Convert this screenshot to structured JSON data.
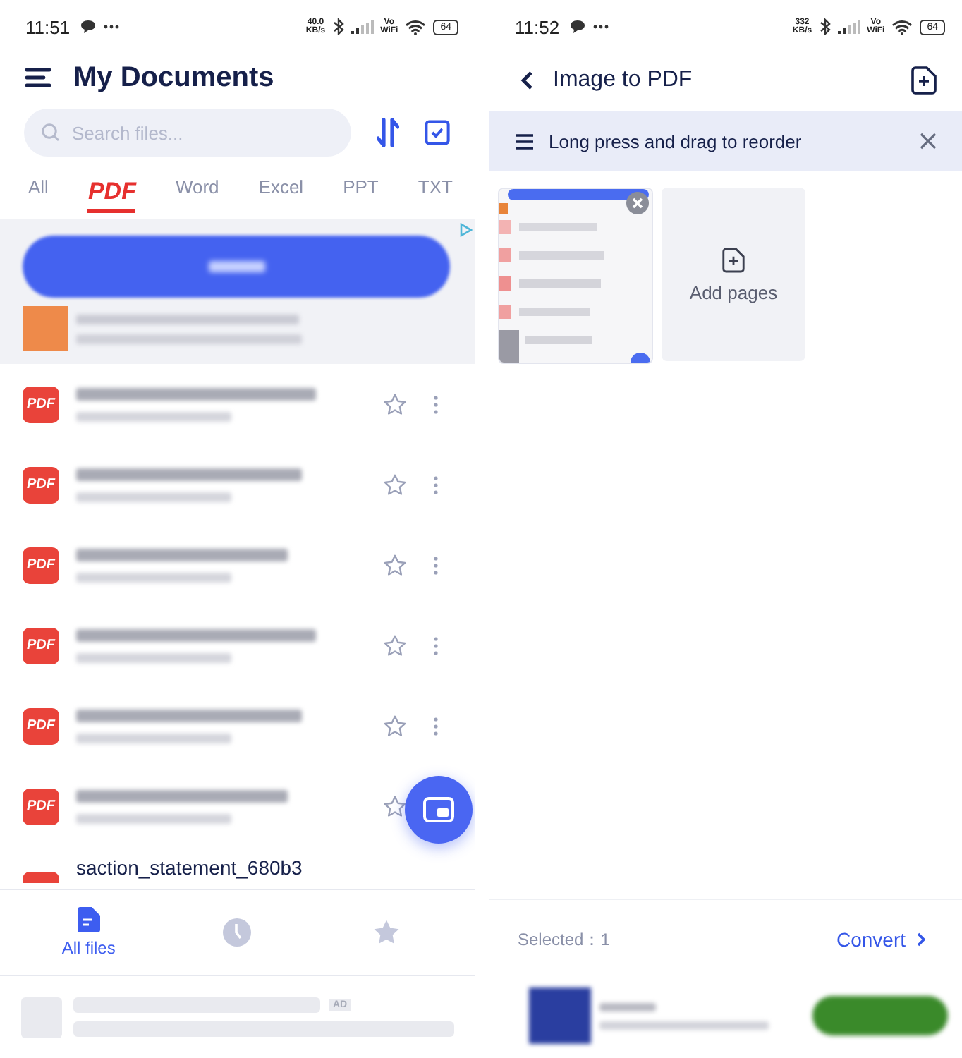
{
  "left": {
    "status_bar": {
      "time": "11:51",
      "speed": [
        "40.0",
        "KB/s"
      ],
      "vowifi": [
        "Vo",
        "WiFi"
      ],
      "battery": "64"
    },
    "header": {
      "title": "My Documents"
    },
    "search": {
      "placeholder": "Search files..."
    },
    "tabs": [
      {
        "label": "All",
        "selected": false
      },
      {
        "label": "PDF",
        "selected": true
      },
      {
        "label": "Word",
        "selected": false
      },
      {
        "label": "Excel",
        "selected": false
      },
      {
        "label": "PPT",
        "selected": false
      },
      {
        "label": "TXT",
        "selected": false
      }
    ],
    "files": [
      {
        "badge": "PDF",
        "starred": false
      },
      {
        "badge": "PDF",
        "starred": false
      },
      {
        "badge": "PDF",
        "starred": false
      },
      {
        "badge": "PDF",
        "starred": false
      },
      {
        "badge": "PDF",
        "starred": false
      },
      {
        "badge": "PDF",
        "starred": false
      }
    ],
    "partial_file": {
      "name": "saction_statement_680b3"
    },
    "bottom_nav": [
      {
        "kind": "files",
        "label": "All files",
        "selected": true
      },
      {
        "kind": "recent",
        "selected": false
      },
      {
        "kind": "starred",
        "selected": false
      }
    ],
    "ad": {
      "badge": "AD"
    }
  },
  "right": {
    "status_bar": {
      "time": "11:52",
      "speed": [
        "332",
        "KB/s"
      ],
      "vowifi": [
        "Vo",
        "WiFi"
      ],
      "battery": "64"
    },
    "header": {
      "title": "Image to PDF"
    },
    "banner": {
      "text": "Long press and drag to reorder"
    },
    "add_pages": {
      "label": "Add pages"
    },
    "footer": {
      "selected": "Selected：1",
      "convert": "Convert"
    }
  }
}
